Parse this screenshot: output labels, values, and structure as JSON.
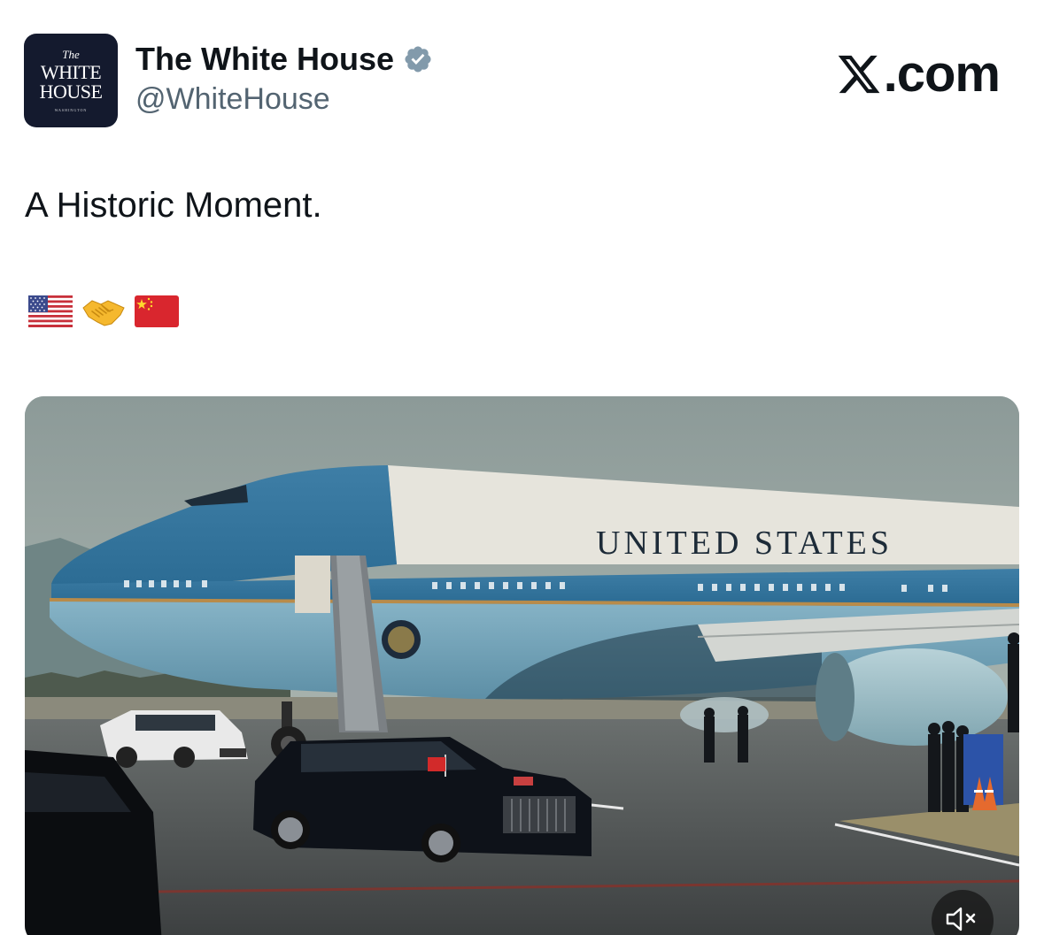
{
  "account": {
    "avatar_lines": [
      "The",
      "WHITE",
      "HOUSE",
      "WASHINGTON"
    ],
    "display_name": "The White House",
    "handle": "@WhiteHouse",
    "verified": true,
    "verified_icon": "verified-badge-icon",
    "verified_color": "#829aab"
  },
  "watermark": {
    "logo_icon": "x-logo-icon",
    "text": ".com"
  },
  "tweet": {
    "text": "A Historic Moment.",
    "emojis": [
      "us-flag-icon",
      "handshake-icon",
      "china-flag-icon"
    ]
  },
  "media": {
    "type": "video",
    "aircraft_livery_text": "UNITED STATES",
    "mute_icon": "speaker-muted-icon"
  }
}
